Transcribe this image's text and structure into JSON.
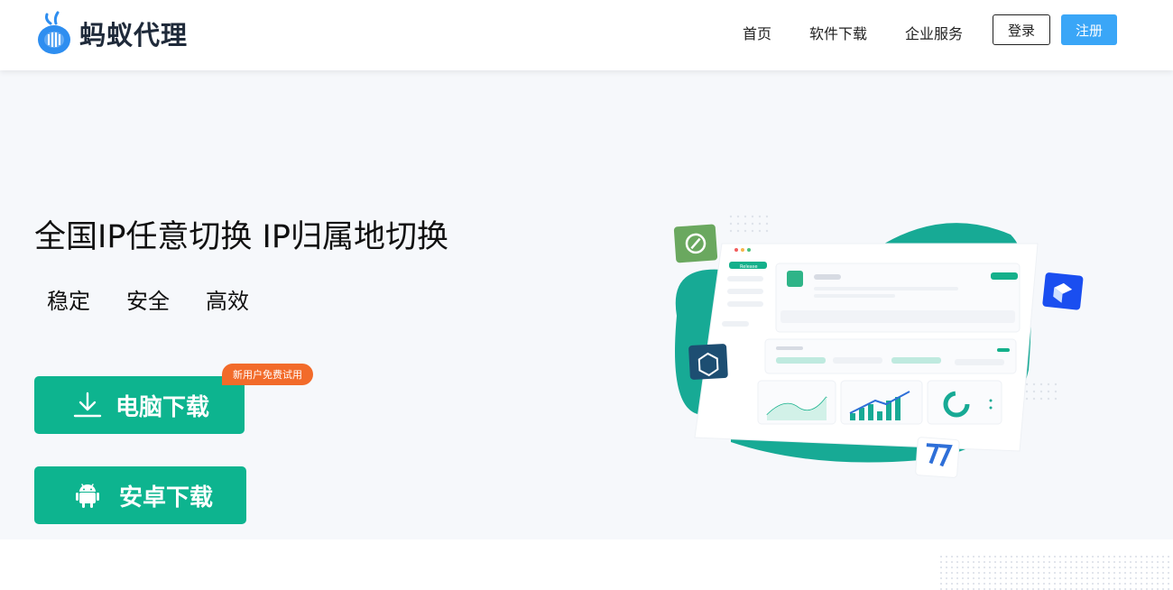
{
  "brand": {
    "name": "蚂蚁代理"
  },
  "nav": {
    "items": [
      "首页",
      "软件下载",
      "企业服务"
    ],
    "login": "登录",
    "register": "注册"
  },
  "hero": {
    "headline": "全国IP任意切换 IP归属地切换",
    "features": [
      "稳定",
      "安全",
      "高效"
    ],
    "badge": "新用户免费试用",
    "pc_download": "电脑下载",
    "android_download": "安卓下载"
  },
  "illustration": {
    "panel_button": "Release"
  },
  "colors": {
    "accent": "#0db48f",
    "register": "#3aa6f7",
    "badge": "#f26b2a"
  }
}
